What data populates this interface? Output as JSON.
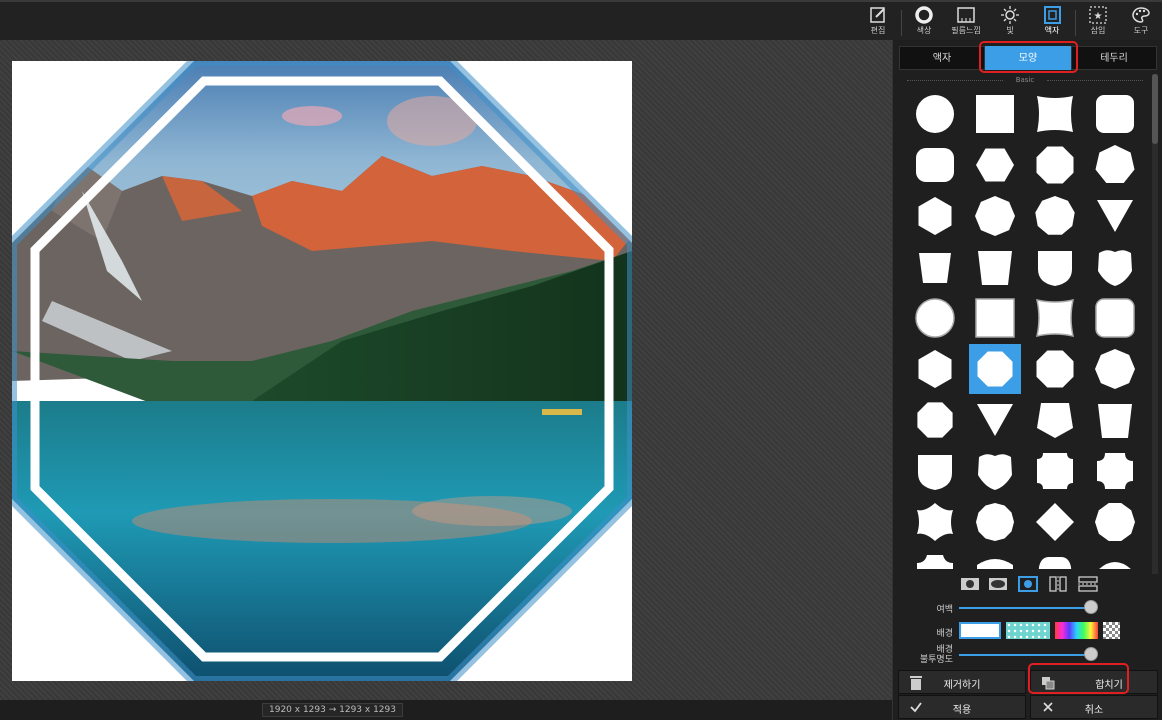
{
  "toolbar": {
    "items": [
      {
        "label": "편집",
        "icon": "edit-icon"
      },
      {
        "label": "색상",
        "icon": "color-circle-icon"
      },
      {
        "label": "필름느낌",
        "icon": "film-icon"
      },
      {
        "label": "빛",
        "icon": "sun-icon"
      },
      {
        "label": "액자",
        "icon": "frame-icon",
        "active": true
      },
      {
        "label": "삽입",
        "icon": "star-frame-icon"
      },
      {
        "label": "도구",
        "icon": "palette-icon"
      }
    ]
  },
  "status": {
    "dimensions": "1920 x 1293 → 1293 x 1293"
  },
  "panel": {
    "tabs": [
      {
        "label": "액자"
      },
      {
        "label": "모양",
        "active": true
      },
      {
        "label": "테두리"
      }
    ],
    "section_title": "Basic",
    "margin_label": "여백",
    "margin_value": 1.0,
    "background_label": "배경",
    "opacity_label_line1": "배경",
    "opacity_label_line2": "불투명도",
    "opacity_value": 1.0,
    "remove_button": "제거하기",
    "merge_button": "합치기",
    "apply_button": "적용",
    "cancel_button": "취소",
    "selected_shape_index": 21,
    "colors": {
      "accent": "#3c9ee6",
      "highlight": "#e02020"
    }
  }
}
